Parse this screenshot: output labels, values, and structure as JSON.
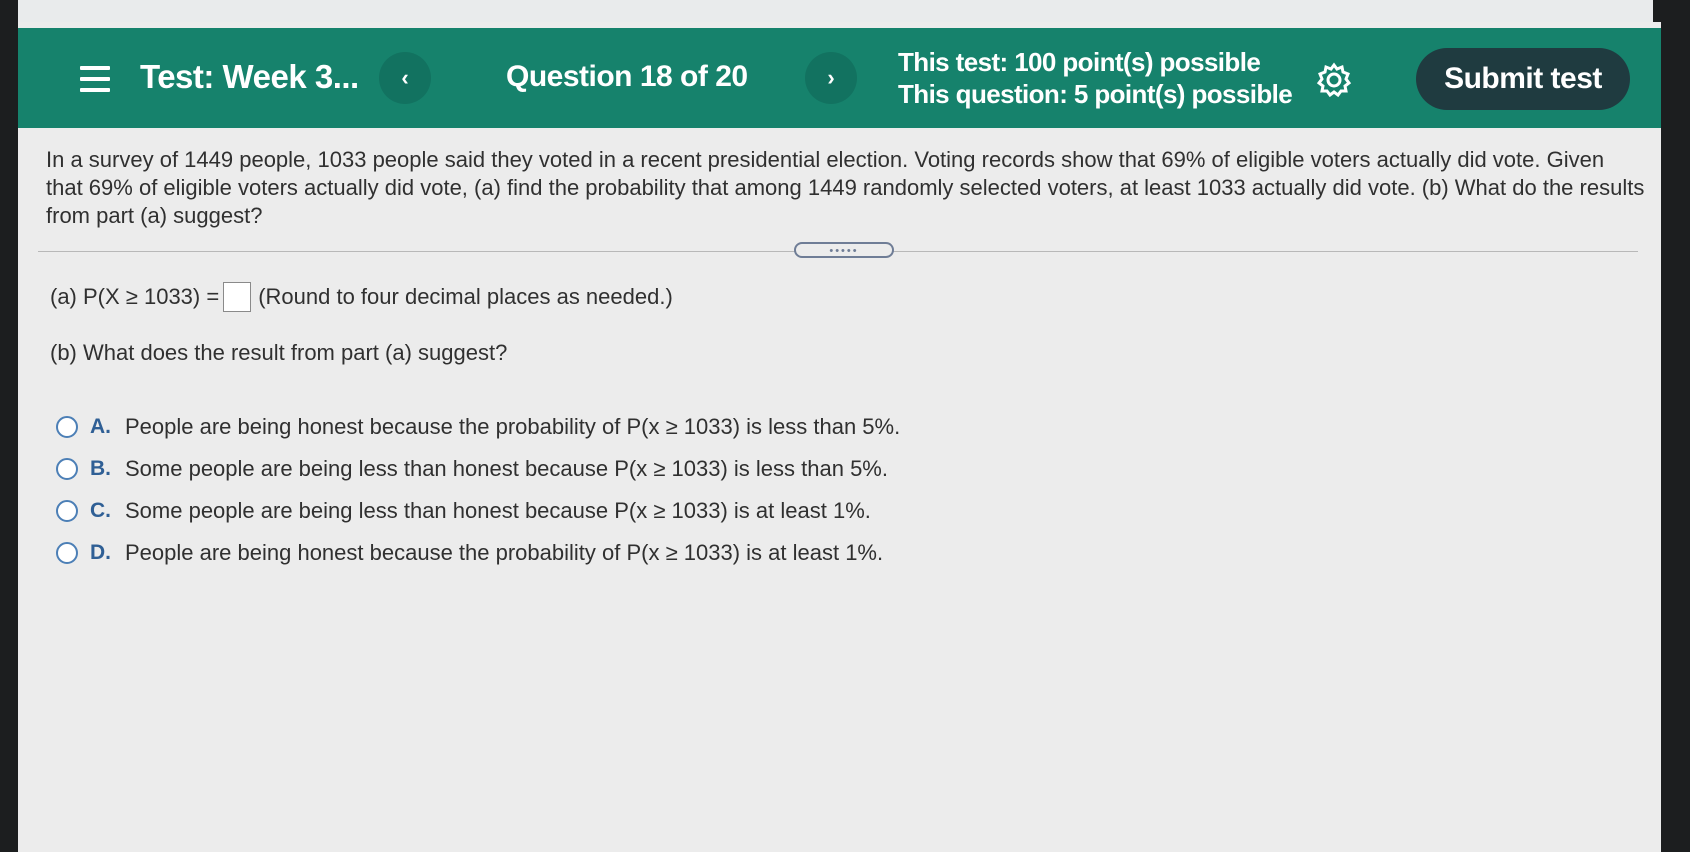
{
  "toolbar": {
    "title": "Test: Week 3...",
    "prev_label": "‹",
    "next_label": "›",
    "question_indicator": "Question 18 of 20",
    "test_points": "This test: 100 point(s) possible",
    "question_points": "This question: 5 point(s) possible",
    "submit_label": "Submit test"
  },
  "question": {
    "text": "In a survey of 1449 people, 1033 people said they voted in a recent presidential election. Voting records show that 69% of eligible voters actually did vote. Given that 69% of eligible voters actually did vote, (a) find the probability that among 1449 randomly selected voters, at least 1033 actually did vote. (b) What do the results from part (a) suggest?",
    "splitter": "•••••",
    "part_a_prefix": "(a) P(X ≥ 1033) =",
    "part_a_answer": "",
    "part_a_hint": "(Round to four decimal places as needed.)",
    "part_b_prompt": "(b) What does the result from part (a) suggest?"
  },
  "options": [
    {
      "letter": "A.",
      "text": "People are being honest because the probability of P(x ≥ 1033) is less than 5%."
    },
    {
      "letter": "B.",
      "text": "Some people are being less than honest because P(x ≥ 1033) is less than 5%."
    },
    {
      "letter": "C.",
      "text": "Some people are being less than honest because P(x ≥ 1033) is at least 1%."
    },
    {
      "letter": "D.",
      "text": "People are being honest because the probability of P(x ≥ 1033) is at least 1%."
    }
  ],
  "colors": {
    "toolbar": "#16826c",
    "submit": "#1f3b40",
    "option_letter": "#2f5f95"
  }
}
